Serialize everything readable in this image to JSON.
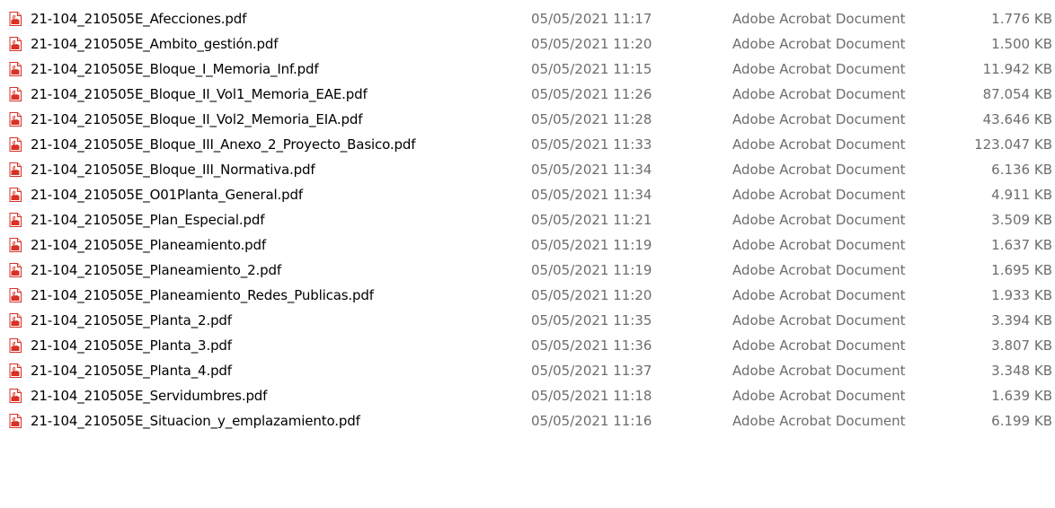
{
  "file_list": {
    "icon": "pdf-file-icon",
    "icon_color": "#d93025",
    "text_color": "#000000",
    "meta_color": "#6d6d6d",
    "rows": [
      {
        "name": "21-104_210505E_Afecciones.pdf",
        "date": "05/05/2021 11:17",
        "type": "Adobe Acrobat Document",
        "size": "1.776 KB"
      },
      {
        "name": "21-104_210505E_Ambito_gestión.pdf",
        "date": "05/05/2021 11:20",
        "type": "Adobe Acrobat Document",
        "size": "1.500 KB"
      },
      {
        "name": "21-104_210505E_Bloque_I_Memoria_Inf.pdf",
        "date": "05/05/2021 11:15",
        "type": "Adobe Acrobat Document",
        "size": "11.942 KB"
      },
      {
        "name": "21-104_210505E_Bloque_II_Vol1_Memoria_EAE.pdf",
        "date": "05/05/2021 11:26",
        "type": "Adobe Acrobat Document",
        "size": "87.054 KB"
      },
      {
        "name": "21-104_210505E_Bloque_II_Vol2_Memoria_EIA.pdf",
        "date": "05/05/2021 11:28",
        "type": "Adobe Acrobat Document",
        "size": "43.646 KB"
      },
      {
        "name": "21-104_210505E_Bloque_III_Anexo_2_Proyecto_Basico.pdf",
        "date": "05/05/2021 11:33",
        "type": "Adobe Acrobat Document",
        "size": "123.047 KB"
      },
      {
        "name": "21-104_210505E_Bloque_III_Normativa.pdf",
        "date": "05/05/2021 11:34",
        "type": "Adobe Acrobat Document",
        "size": "6.136 KB"
      },
      {
        "name": "21-104_210505E_O01Planta_General.pdf",
        "date": "05/05/2021 11:34",
        "type": "Adobe Acrobat Document",
        "size": "4.911 KB"
      },
      {
        "name": "21-104_210505E_Plan_Especial.pdf",
        "date": "05/05/2021 11:21",
        "type": "Adobe Acrobat Document",
        "size": "3.509 KB"
      },
      {
        "name": "21-104_210505E_Planeamiento.pdf",
        "date": "05/05/2021 11:19",
        "type": "Adobe Acrobat Document",
        "size": "1.637 KB"
      },
      {
        "name": "21-104_210505E_Planeamiento_2.pdf",
        "date": "05/05/2021 11:19",
        "type": "Adobe Acrobat Document",
        "size": "1.695 KB"
      },
      {
        "name": "21-104_210505E_Planeamiento_Redes_Publicas.pdf",
        "date": "05/05/2021 11:20",
        "type": "Adobe Acrobat Document",
        "size": "1.933 KB"
      },
      {
        "name": "21-104_210505E_Planta_2.pdf",
        "date": "05/05/2021 11:35",
        "type": "Adobe Acrobat Document",
        "size": "3.394 KB"
      },
      {
        "name": "21-104_210505E_Planta_3.pdf",
        "date": "05/05/2021 11:36",
        "type": "Adobe Acrobat Document",
        "size": "3.807 KB"
      },
      {
        "name": "21-104_210505E_Planta_4.pdf",
        "date": "05/05/2021 11:37",
        "type": "Adobe Acrobat Document",
        "size": "3.348 KB"
      },
      {
        "name": "21-104_210505E_Servidumbres.pdf",
        "date": "05/05/2021 11:18",
        "type": "Adobe Acrobat Document",
        "size": "1.639 KB"
      },
      {
        "name": "21-104_210505E_Situacion_y_emplazamiento.pdf",
        "date": "05/05/2021 11:16",
        "type": "Adobe Acrobat Document",
        "size": "6.199 KB"
      }
    ]
  }
}
